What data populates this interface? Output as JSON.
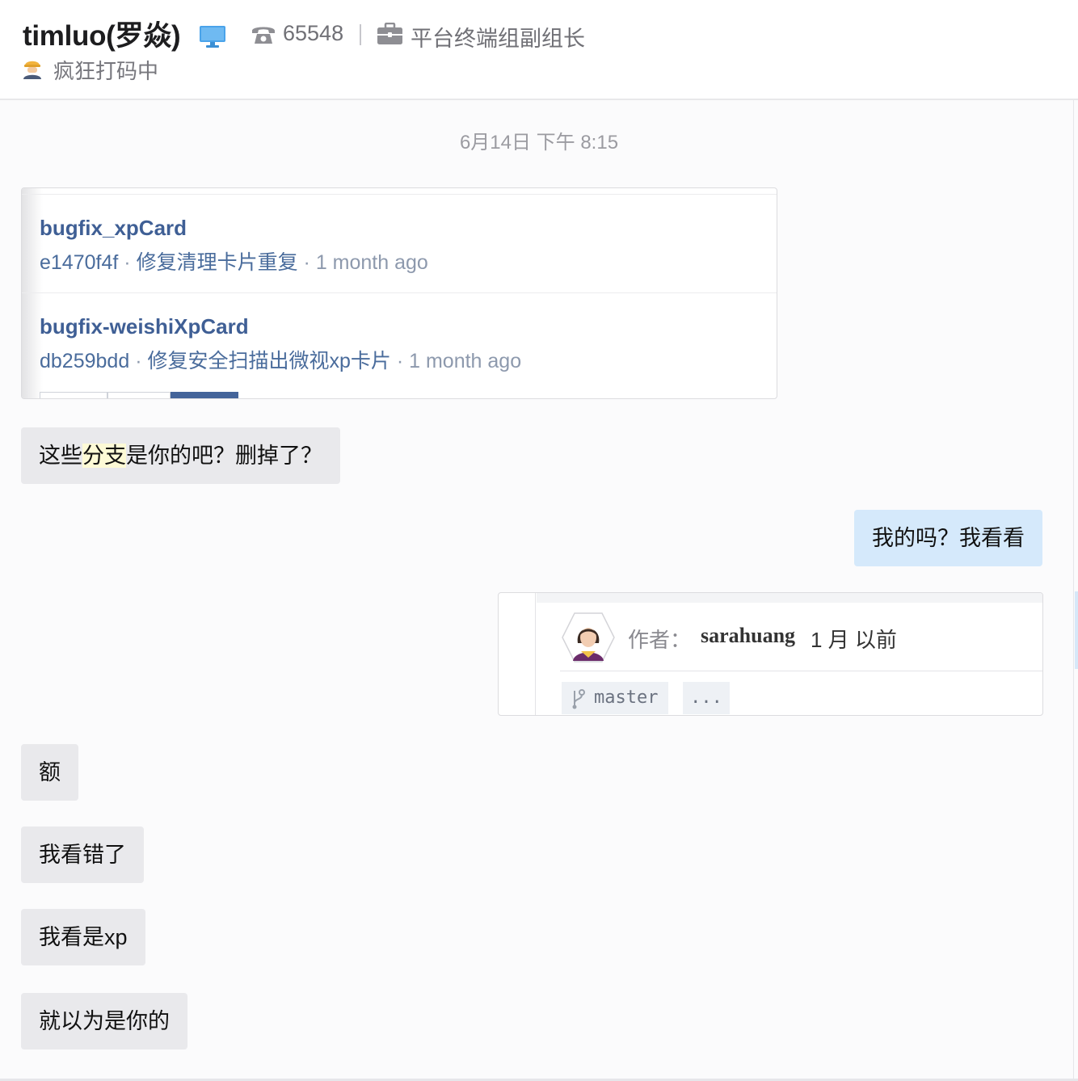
{
  "header": {
    "name": "timluo(罗焱)",
    "extension": "65548",
    "job_title": "平台终端组副组长",
    "status_text": "疯狂打码中",
    "icons": [
      "monitor-icon",
      "phone-icon",
      "briefcase-icon",
      "worker-icon"
    ]
  },
  "chat": {
    "timestamp": "6月14日 下午 8:15",
    "branch_card": {
      "items": [
        {
          "name": "bugfix_xpCard",
          "hash": "e1470f4f",
          "message": "修复清理卡片重复",
          "time": "1 month ago"
        },
        {
          "name": "bugfix-weishiXpCard",
          "hash": "db259bdd",
          "message": "修复安全扫描出微视xp卡片",
          "time": "1 month ago"
        }
      ],
      "separator": "·"
    },
    "msg1": {
      "before": "这些",
      "highlight": "分支",
      "after": "是你的吧？删掉了？"
    },
    "msg2": "我的吗？我看看",
    "commit_card": {
      "author_label": "作者：",
      "author_name": "sarahuang",
      "time": "1 月 以前",
      "branch": "master",
      "more": "..."
    },
    "msg3": "额",
    "msg4": "我看错了",
    "msg5": "我看是xp",
    "msg6": "就以为是你的"
  },
  "colors": {
    "incoming_bubble": "#e9e9ec",
    "outgoing_bubble": "#d5e9fb",
    "branch_link": "#3f5f95",
    "highlight": "#fdfad6"
  }
}
